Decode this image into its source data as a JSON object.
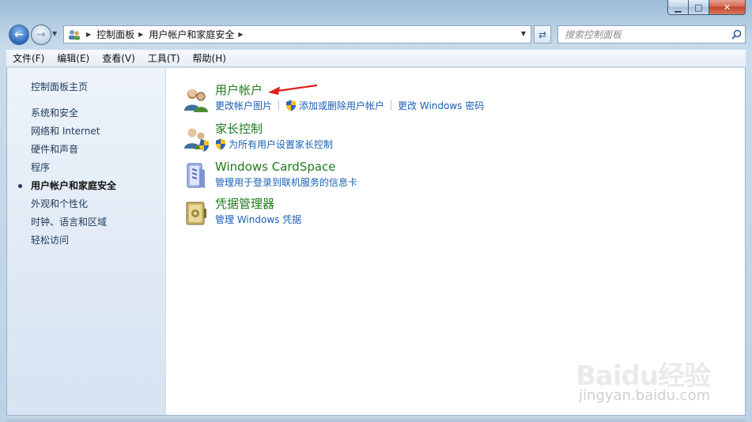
{
  "window": {
    "caption": {
      "minimize": "▁",
      "maximize": "□",
      "close": "✕"
    }
  },
  "address": {
    "crumbs": [
      "控制面板",
      "用户帐户和家庭安全"
    ]
  },
  "search": {
    "placeholder": "搜索控制面板"
  },
  "menubar": {
    "items": [
      "文件(F)",
      "编辑(E)",
      "查看(V)",
      "工具(T)",
      "帮助(H)"
    ]
  },
  "sidebar": {
    "home": "控制面板主页",
    "items": [
      "系统和安全",
      "网络和 Internet",
      "硬件和声音",
      "程序",
      "用户帐户和家庭安全",
      "外观和个性化",
      "时钟、语言和区域",
      "轻松访问"
    ],
    "current_index": 4
  },
  "categories": [
    {
      "title": "用户帐户",
      "icon": "users-icon",
      "links": [
        {
          "label": "更改帐户图片",
          "shield": false
        },
        {
          "label": "添加或删除用户帐户",
          "shield": true
        },
        {
          "label": "更改 Windows 密码",
          "shield": false
        }
      ]
    },
    {
      "title": "家长控制",
      "icon": "parental-control-icon",
      "links": [
        {
          "label": "为所有用户设置家长控制",
          "shield": true
        }
      ]
    },
    {
      "title": "Windows CardSpace",
      "icon": "cardspace-icon",
      "links": [
        {
          "label": "管理用于登录到联机服务的信息卡",
          "shield": false
        }
      ]
    },
    {
      "title": "凭据管理器",
      "icon": "credential-manager-icon",
      "links": [
        {
          "label": "管理 Windows 凭据",
          "shield": false
        }
      ]
    }
  ],
  "watermark": {
    "logo": "Baidu经验",
    "url": "jingyan.baidu.com"
  },
  "colors": {
    "category_title": "#1f7a1f",
    "link": "#1a5fb4",
    "sidebar_link": "#1e395b",
    "arrow": "#e0201b"
  }
}
